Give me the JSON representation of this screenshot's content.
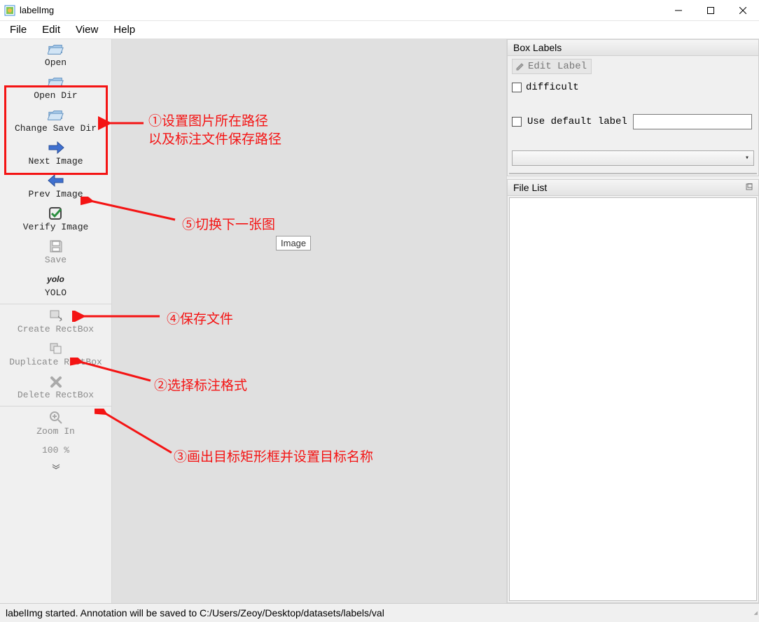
{
  "title": "labelImg",
  "menu": {
    "file": "File",
    "edit": "Edit",
    "view": "View",
    "help": "Help"
  },
  "toolbar": {
    "open": "Open",
    "open_dir": "Open Dir",
    "change_save_dir": "Change Save Dir",
    "next_image": "Next Image",
    "prev_image": "Prev Image",
    "verify_image": "Verify Image",
    "save": "Save",
    "format": "YOLO",
    "create_rect": "Create RectBox",
    "duplicate_rect": "Duplicate RectBox",
    "delete_rect": "Delete RectBox",
    "zoom_in": "Zoom In",
    "zoom_pct": "100 %"
  },
  "right": {
    "box_labels": "Box Labels",
    "edit_label": "Edit Label",
    "difficult": "difficult",
    "use_default_label": "Use default label",
    "file_list": "File List"
  },
  "tooltip": "Image",
  "annotations": {
    "step1a": "①设置图片所在路径",
    "step1b": "以及标注文件保存路径",
    "step2": "②选择标注格式",
    "step3": "③画出目标矩形框并设置目标名称",
    "step4": "④保存文件",
    "step5": "⑤切换下一张图"
  },
  "status": "labelImg started. Annotation will be saved to C:/Users/Zeoy/Desktop/datasets/labels/val",
  "format_icon_text": "yolo"
}
